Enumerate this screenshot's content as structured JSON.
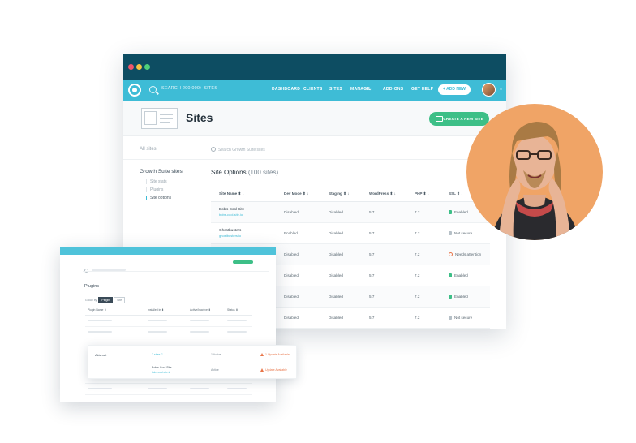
{
  "topbar": {
    "search_text": "SEARCH 200,000+ SITES",
    "nav": [
      "DASHBOARD",
      "CLIENTS",
      "SITES",
      "MANAGE",
      "ADD-ONS",
      "GET HELP"
    ],
    "add_new": "+ ADD NEW"
  },
  "header": {
    "title": "Sites",
    "create_button": "CREATE A NEW SITE"
  },
  "subnav": {
    "all_sites": "All sites",
    "search_placeholder": "Search Growth Suite sites"
  },
  "sidebar": {
    "title": "Growth Suite sites",
    "items": [
      {
        "label": "Site stats"
      },
      {
        "label": "Plugins"
      },
      {
        "label": "Site options"
      }
    ]
  },
  "section": {
    "title": "Site Options",
    "count": "(100 sites)"
  },
  "table": {
    "columns": [
      "Site Name ⬍ ↓",
      "Dev Mode ⬍ ↓",
      "Staging ⬍ ↓",
      "WordPress ⬍ ↓",
      "PHP ⬍ ↓",
      "SSL ⬍ ↓"
    ],
    "rows": [
      {
        "name": "Bob's Cool Site",
        "link": "bobs-cool-site.io",
        "dev": "Disabled",
        "staging": "Disabled",
        "wp": "5.7",
        "php": "7.2",
        "ssl": "Enabled",
        "ssl_state": "ok"
      },
      {
        "name": "Ghostbusters",
        "link": "ghostbusters.io",
        "dev": "Enabled",
        "staging": "Disabled",
        "wp": "5.7",
        "php": "7.2",
        "ssl": "Not secure",
        "ssl_state": "none"
      },
      {
        "name": "",
        "link": "",
        "dev": "Disabled",
        "staging": "Disabled",
        "wp": "5.7",
        "php": "7.2",
        "ssl": "Needs attention",
        "ssl_state": "warn"
      },
      {
        "name": "",
        "link": "",
        "dev": "Disabled",
        "staging": "Disabled",
        "wp": "5.7",
        "php": "7.2",
        "ssl": "Enabled",
        "ssl_state": "ok"
      },
      {
        "name": "",
        "link": "",
        "dev": "Disabled",
        "staging": "Disabled",
        "wp": "5.7",
        "php": "7.2",
        "ssl": "Enabled",
        "ssl_state": "ok"
      },
      {
        "name": "",
        "link": "",
        "dev": "Disabled",
        "staging": "Disabled",
        "wp": "5.7",
        "php": "7.2",
        "ssl": "Not secure",
        "ssl_state": "none"
      }
    ]
  },
  "plugins_panel": {
    "title": "Plugins",
    "toggle_label": "Group by",
    "toggle_on": "Plugin",
    "toggle_off": "Site",
    "columns": [
      "Plugin Name ⬍",
      "Installed in ⬍",
      "Active/Inactive ⬍",
      "Status ⬍"
    ],
    "card": {
      "name": "Akismet",
      "version": "2 sites ⌃",
      "active": "1 Active",
      "update": "1 Update Available",
      "site_name": "Bob's Cool Site",
      "site_link": "bobs-cool-site.io",
      "site_active": "Active",
      "site_update": "Update Available"
    }
  },
  "colors": {
    "chrome": "#0d4d62",
    "nav": "#3ebcd6",
    "create": "#3dbf87",
    "person_bg": "#f0a466"
  }
}
